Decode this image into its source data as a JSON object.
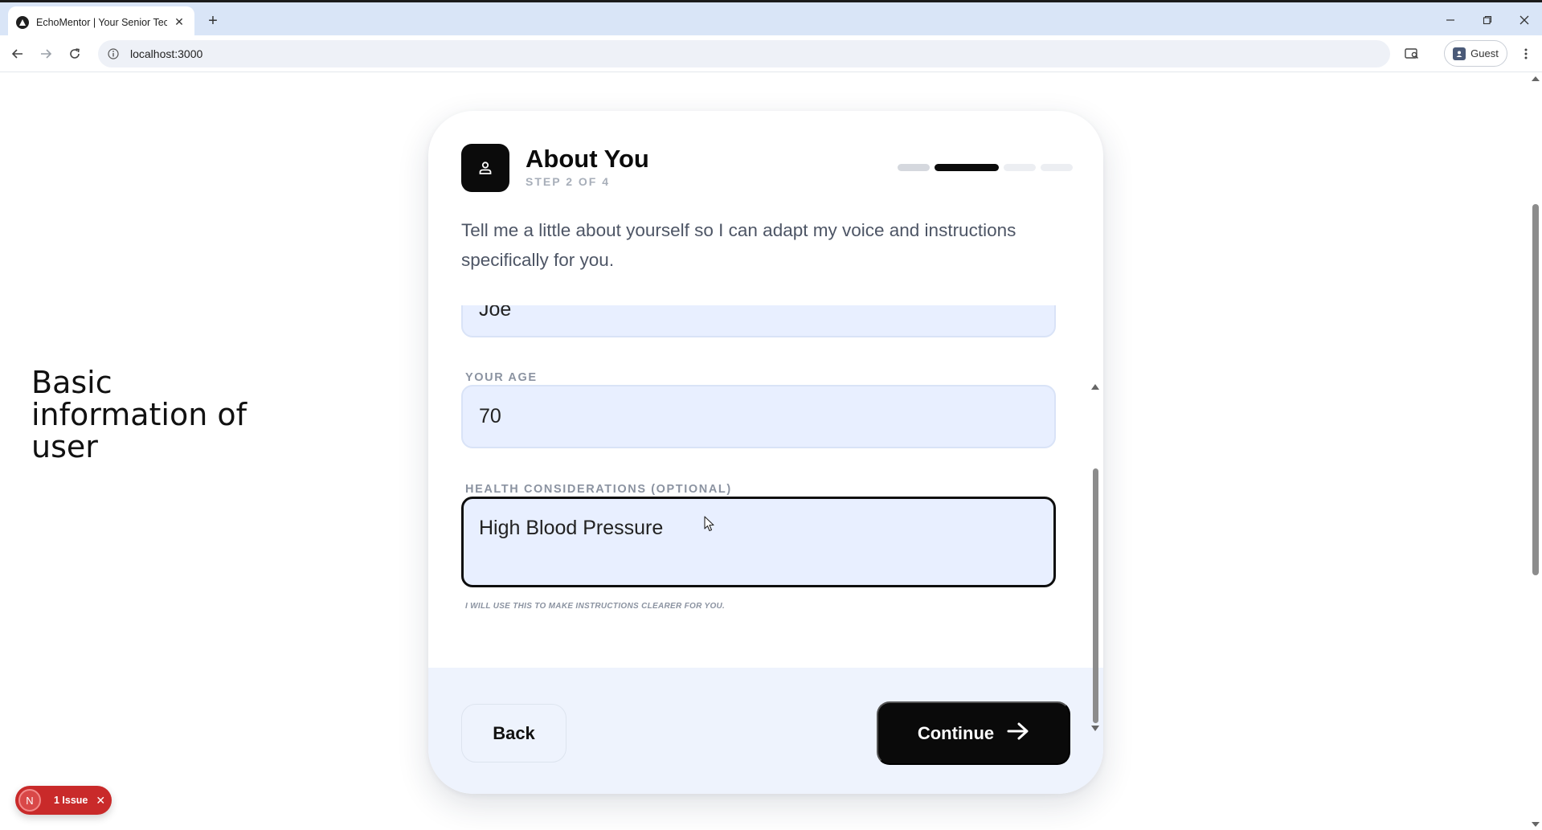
{
  "browser": {
    "tab_title": "EchoMentor | Your Senior Tech",
    "new_tab_symbol": "+",
    "url": "localhost:3000",
    "profile_label": "Guest"
  },
  "page": {
    "side_caption": "Basic information of user"
  },
  "card": {
    "title": "About You",
    "step": "STEP 2 OF 4",
    "progress": {
      "current_step": 2,
      "total_steps": 4
    },
    "intro": "Tell me a little about yourself so I can adapt my voice and instructions specifically for you.",
    "fields": {
      "name_value": "Joe",
      "age_label": "YOUR AGE",
      "age_value": "70",
      "health_label": "HEALTH CONSIDERATIONS (OPTIONAL)",
      "health_value": "High Blood Pressure",
      "health_hint": "I WILL USE THIS TO MAKE INSTRUCTIONS CLEARER FOR YOU."
    },
    "buttons": {
      "back": "Back",
      "continue": "Continue"
    }
  },
  "dev_overlay": {
    "badge_letter": "N",
    "issue_text": "1 Issue"
  },
  "colors": {
    "accent": "#0a0a0a",
    "input_bg": "#e8efff",
    "footer_bg": "#eef3fd",
    "issue_red": "#c92a2a",
    "chrome_tabbar": "#d9e5f7"
  },
  "icons": [
    "browser-favicon",
    "close-icon",
    "back-arrow-icon",
    "forward-arrow-icon",
    "reload-icon",
    "info-icon",
    "reading-mode-icon",
    "profile-icon",
    "more-vert-icon",
    "user-icon",
    "arrow-right-icon",
    "minimize-icon",
    "maximize-icon"
  ]
}
